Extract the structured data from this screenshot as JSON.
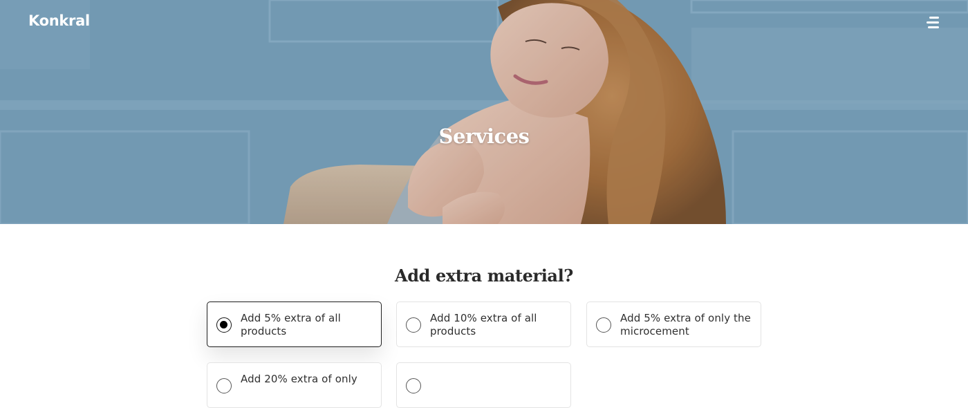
{
  "header": {
    "logo": "Konkral",
    "menu_icon": "hamburger-menu-icon"
  },
  "hero": {
    "title": "Services",
    "image": "woman-with-curly-hair-photo"
  },
  "question": {
    "title": "Add extra material?",
    "options": [
      {
        "label": "Add 5% extra of all products",
        "selected": true
      },
      {
        "label": "Add 10% extra of all products",
        "selected": false
      },
      {
        "label": "Add 5% extra of only the microcement",
        "selected": false
      },
      {
        "label": "Add 20% extra of only",
        "selected": false
      },
      {
        "label": "",
        "selected": false
      }
    ]
  }
}
